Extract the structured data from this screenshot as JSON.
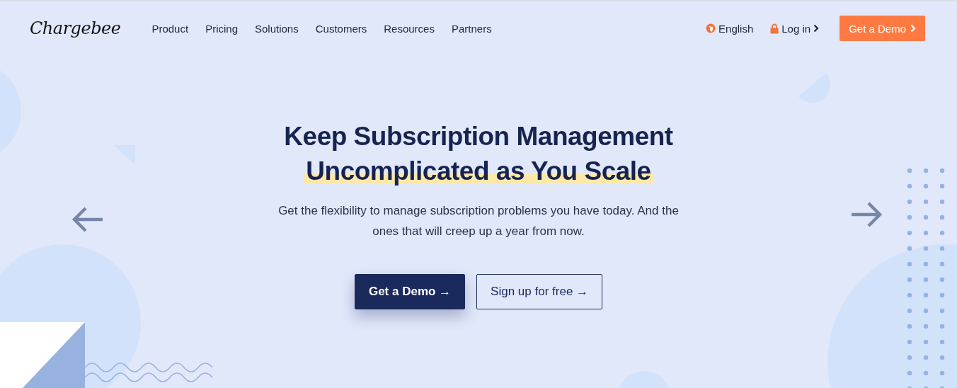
{
  "nav": {
    "logo": "Chargebee",
    "links": [
      "Product",
      "Pricing",
      "Solutions",
      "Customers",
      "Resources",
      "Partners"
    ],
    "language": "English",
    "login": "Log in",
    "cta": "Get a Demo"
  },
  "hero": {
    "headline": [
      {
        "text": "Keep Subscription Management",
        "highlighted": false
      },
      {
        "text": "Uncomplicated as You Scale",
        "highlighted": true
      }
    ],
    "subtitle": "Get the flexibility to manage subscription problems you have today. And the ones that will creep up a year from now.",
    "buttons": [
      {
        "label": "Get a Demo →",
        "kind": "primary"
      },
      {
        "label": "Sign up for free →",
        "kind": "secondary"
      }
    ]
  }
}
